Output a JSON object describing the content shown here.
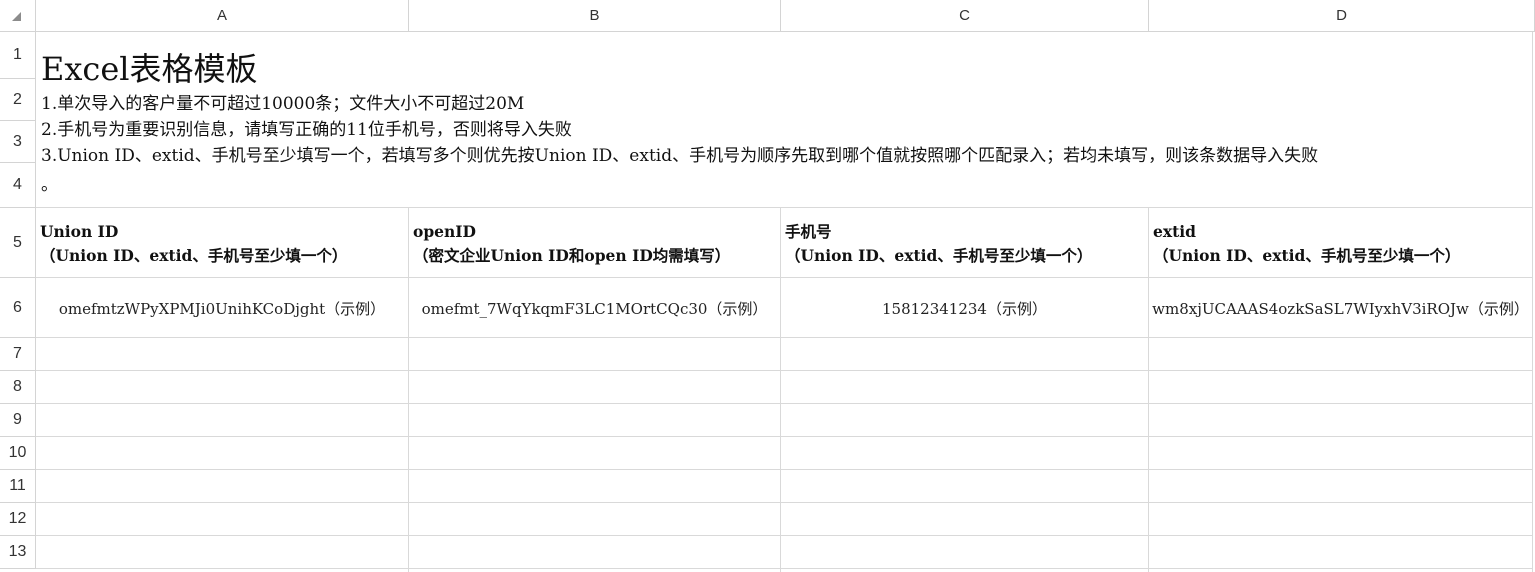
{
  "columns": [
    "A",
    "B",
    "C",
    "D"
  ],
  "rows": [
    "1",
    "2",
    "3",
    "4",
    "5",
    "6",
    "7",
    "8",
    "9",
    "10",
    "11",
    "12",
    "13"
  ],
  "notes": {
    "title": "Excel表格模板",
    "line1": "1.单次导入的客户量不可超过10000条；文件大小不可超过20M",
    "line2": "2.手机号为重要识别信息，请填写正确的11位手机号，否则将导入失败",
    "line3": "3.Union ID、extid、手机号至少填写一个，若填写多个则优先按Union ID、extid、手机号为顺序先取到哪个值就按照哪个匹配录入；若均未填写，则该条数据导入失败",
    "line4": "。"
  },
  "headers": [
    {
      "name": "Union ID",
      "note": "（Union ID、extid、手机号至少填一个）"
    },
    {
      "name": "openID",
      "note": "（密文企业Union ID和open ID均需填写）"
    },
    {
      "name": "手机号",
      "note": "（Union ID、extid、手机号至少填一个）"
    },
    {
      "name": "extid",
      "note": "（Union ID、extid、手机号至少填一个）"
    }
  ],
  "examples": [
    "omefmtzWPyXPMJi0UnihKCoDjght（示例）",
    "omefmt_7WqYkqmF3LC1MOrtCQc30（示例）",
    "15812341234（示例）",
    "wm8xjUCAAAS4ozkSaSL7WIyxhV3iROJw（示例）"
  ]
}
